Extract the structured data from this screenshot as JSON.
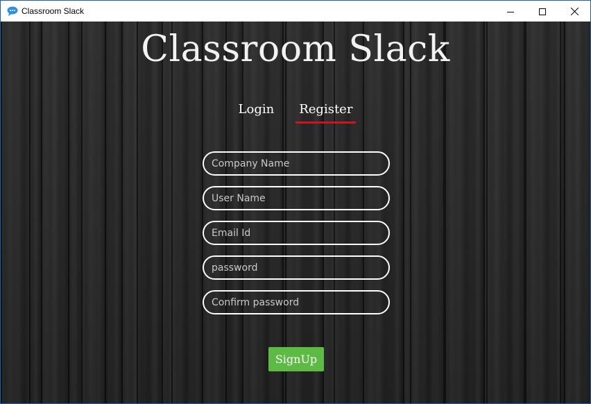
{
  "window": {
    "title": "Classroom Slack",
    "icon": "chat-bubble-icon",
    "controls": [
      "minimize-icon",
      "maximize-icon",
      "close-icon"
    ]
  },
  "app": {
    "title": "Classroom Slack"
  },
  "tabs": [
    {
      "label": "Login",
      "active": false
    },
    {
      "label": "Register",
      "active": true
    }
  ],
  "form": {
    "fields": [
      {
        "placeholder": "Company Name",
        "value": ""
      },
      {
        "placeholder": "User Name",
        "value": ""
      },
      {
        "placeholder": "Email Id",
        "value": ""
      },
      {
        "placeholder": "password",
        "value": ""
      },
      {
        "placeholder": "Confirm password",
        "value": ""
      }
    ],
    "submit_label": "SignUp"
  },
  "colors": {
    "accent_underline": "#d0141b",
    "signup_button": "#5dba45",
    "window_border": "#1e5fa8"
  }
}
